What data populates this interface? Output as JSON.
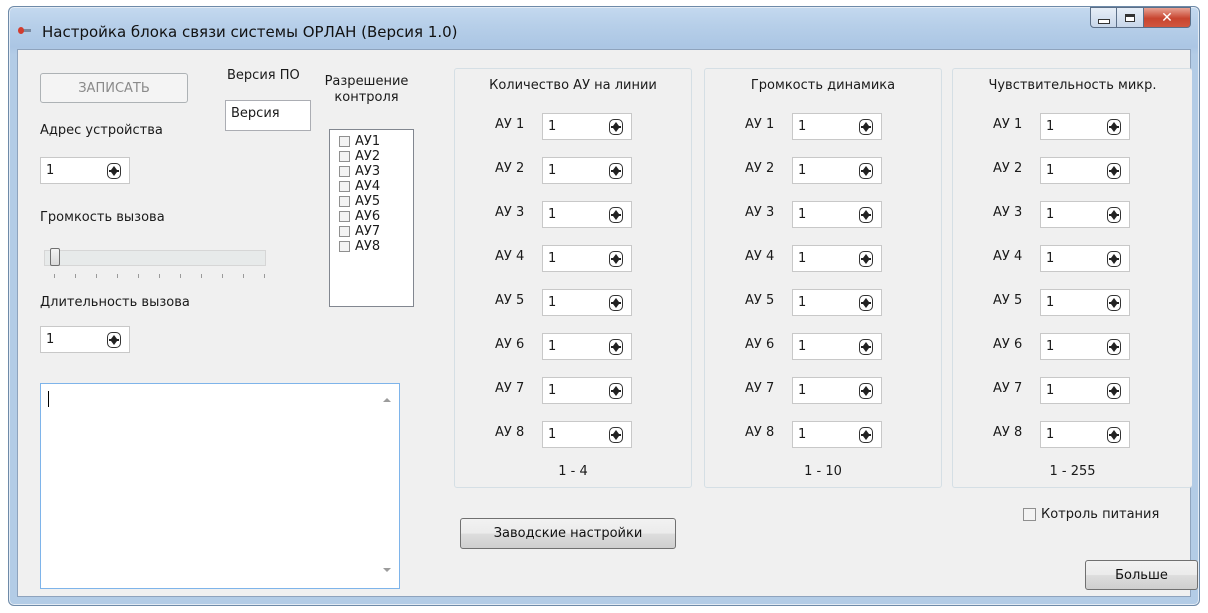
{
  "window": {
    "title": "Настройка блока связи системы ОРЛАН (Версия 1.0)",
    "close_glyph": "✕"
  },
  "left": {
    "write_button": "ЗАПИСАТЬ",
    "address_label": "Адрес устройства",
    "address_value": "1",
    "call_volume_label": "Громкость вызова",
    "call_volume_level": 0,
    "call_duration_label": "Длительность вызова",
    "call_duration_value": "1",
    "memo_text": ""
  },
  "version": {
    "label": "Версия ПО",
    "value": "Версия"
  },
  "control_permission": {
    "label": "Разрешение контроля",
    "items": [
      "АУ1",
      "АУ2",
      "АУ3",
      "АУ4",
      "АУ5",
      "АУ6",
      "АУ7",
      "АУ8"
    ]
  },
  "groups": [
    {
      "title": "Количество АУ на линии",
      "range": "1 - 4",
      "rows": [
        {
          "label": "АУ 1",
          "value": "1"
        },
        {
          "label": "АУ 2",
          "value": "1"
        },
        {
          "label": "АУ 3",
          "value": "1"
        },
        {
          "label": "АУ 4",
          "value": "1"
        },
        {
          "label": "АУ 5",
          "value": "1"
        },
        {
          "label": "АУ 6",
          "value": "1"
        },
        {
          "label": "АУ 7",
          "value": "1"
        },
        {
          "label": "АУ 8",
          "value": "1"
        }
      ]
    },
    {
      "title": "Громкость динамика",
      "range": "1 - 10",
      "rows": [
        {
          "label": "АУ 1",
          "value": "1"
        },
        {
          "label": "АУ 2",
          "value": "1"
        },
        {
          "label": "АУ 3",
          "value": "1"
        },
        {
          "label": "АУ 4",
          "value": "1"
        },
        {
          "label": "АУ 5",
          "value": "1"
        },
        {
          "label": "АУ 6",
          "value": "1"
        },
        {
          "label": "АУ 7",
          "value": "1"
        },
        {
          "label": "АУ 8",
          "value": "1"
        }
      ]
    },
    {
      "title": "Чувствительность микр.",
      "range": "1 - 255",
      "rows": [
        {
          "label": "АУ 1",
          "value": "1"
        },
        {
          "label": "АУ 2",
          "value": "1"
        },
        {
          "label": "АУ 3",
          "value": "1"
        },
        {
          "label": "АУ 4",
          "value": "1"
        },
        {
          "label": "АУ 5",
          "value": "1"
        },
        {
          "label": "АУ 6",
          "value": "1"
        },
        {
          "label": "АУ 7",
          "value": "1"
        },
        {
          "label": "АУ 8",
          "value": "1"
        }
      ]
    }
  ],
  "bottom": {
    "factory_button": "Заводские настройки",
    "power_control_label": "Котроль питания",
    "more_button": "Больше"
  }
}
